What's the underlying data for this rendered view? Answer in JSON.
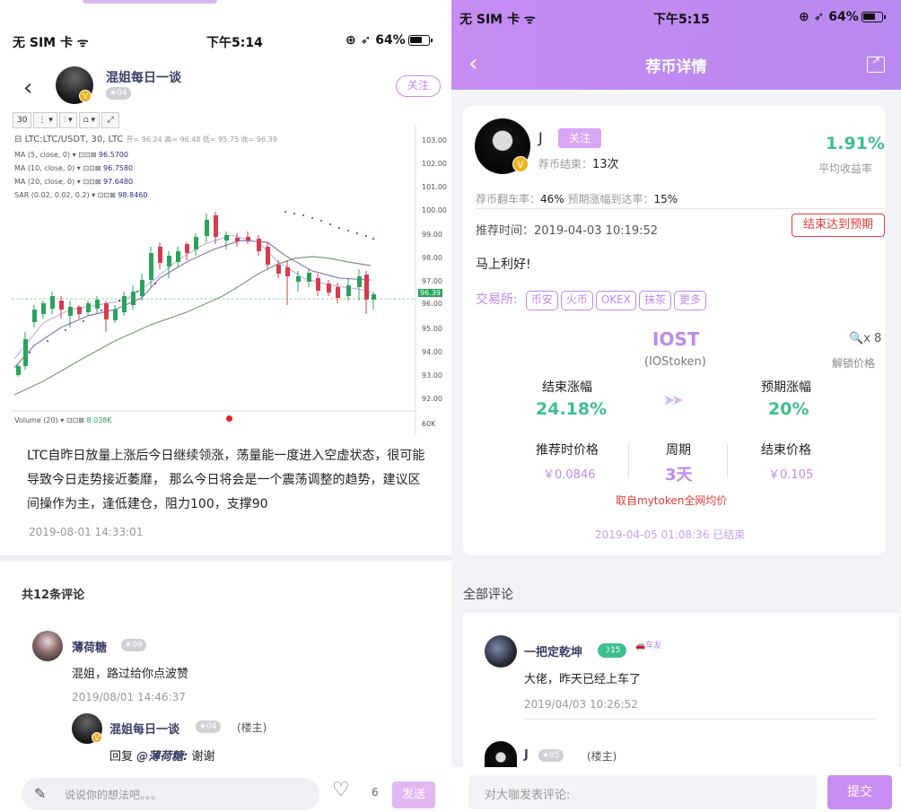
{
  "left": {
    "status_bar": {
      "carrier": "无 SIM 卡 ",
      "time": "下午5:14",
      "battery": "64%"
    },
    "header": {
      "author": "混姐每日一谈",
      "level": "04",
      "follow": "关注"
    },
    "chart": {
      "interval": "30",
      "symbol": "LTC:LTC/USDT, 30, LTC",
      "ohlc": "开= 96.24 高= 96.48 低= 95.75 收= 96.39",
      "indicators": [
        {
          "name": "MA (5, close, 0)",
          "value": "96.5700"
        },
        {
          "name": "MA (10, close, 0)",
          "value": "96.7580"
        },
        {
          "name": "MA (20, close, 0)",
          "value": "97.6480"
        },
        {
          "name": "SAR (0.02, 0.02, 0.2)",
          "value": "98.8460"
        }
      ],
      "volume_label": "Volume (20)",
      "volume_value": "8.038K",
      "current_price": "96.39",
      "volume_axis": "60K",
      "price_ticks": [
        "103.00",
        "102.00",
        "101.00",
        "100.00",
        "99.00",
        "98.00",
        "97.00",
        "96.00",
        "95.00",
        "94.00",
        "93.00",
        "92.00"
      ]
    },
    "post": {
      "text": "LTC自昨日放量上涨后今日继续领涨，荡量能一度进入空虚状态，很可能导致今日走势接近萎靡， 那么今日将会是一个震荡调整的趋势，建议区间操作为主，逢低建仓，阻力100，支撑90",
      "time": "2019-08-01 14:33:01"
    },
    "comments_title": "共12条评论",
    "comment1": {
      "name": "薄荷糖",
      "level": "09",
      "text": "混姐，路过给你点波赞",
      "time": "2019/08/01 14:46:37"
    },
    "reply1": {
      "name": "混姐每日一谈",
      "level": "04",
      "owner": "(楼主)",
      "prefix": "回复 ",
      "mention": "@薄荷糖:",
      "text": " 谢谢"
    },
    "bottom": {
      "placeholder": "说说你的想法吧。。。",
      "likes": "6",
      "send": "发送"
    }
  },
  "right": {
    "status_bar": {
      "carrier": "无 SIM 卡 ",
      "time": "下午5:15",
      "battery": "64%"
    },
    "title": "荐币详情",
    "user": {
      "name": "J",
      "follow": "关注",
      "rec_label": "荐币结束：",
      "rec_value": "13次"
    },
    "avg_return": {
      "value": "1.91%",
      "label": "平均收益率"
    },
    "flip_rate": {
      "label": "荐币翻车率：",
      "value": "46%",
      "reach_label": " 预期涨幅到达率：",
      "reach_value": "15%"
    },
    "rec_time": "推荐时间：2019-04-03 10:19:52",
    "result_tag": "结束达到预期",
    "content": "马上利好!",
    "exchanges": {
      "label": "交易所:",
      "items": [
        "币安",
        "火币",
        "OKEX",
        "抹茶",
        "更多"
      ]
    },
    "coin": {
      "symbol": "IOST",
      "full": "(IOStoken)",
      "lock_count": "x 8",
      "lock_label": "解锁价格"
    },
    "end_gain": {
      "label": "结束涨幅",
      "value": "24.18%"
    },
    "expected_gain": {
      "label": "预期涨幅",
      "value": "20%"
    },
    "rec_price": {
      "label": "推荐时价格",
      "value": "￥0.0846"
    },
    "period": {
      "label": "周期",
      "value": "3天"
    },
    "end_price": {
      "label": "结束价格",
      "value": "￥0.105"
    },
    "source": "取自mytoken全网均价",
    "end_time": "2019-04-05 01:08:36 已结束",
    "all_comments": "全部评论",
    "comment1": {
      "name": "一把定乾坤",
      "level": "15",
      "badge": "车友",
      "text": "大佬，昨天已经上车了",
      "time": "2019/04/03 10:26:52"
    },
    "comment2": {
      "name": "J",
      "level": "05",
      "owner": "(楼主)"
    },
    "bottom": {
      "placeholder": "对大咖发表评论:",
      "submit": "提交"
    }
  }
}
